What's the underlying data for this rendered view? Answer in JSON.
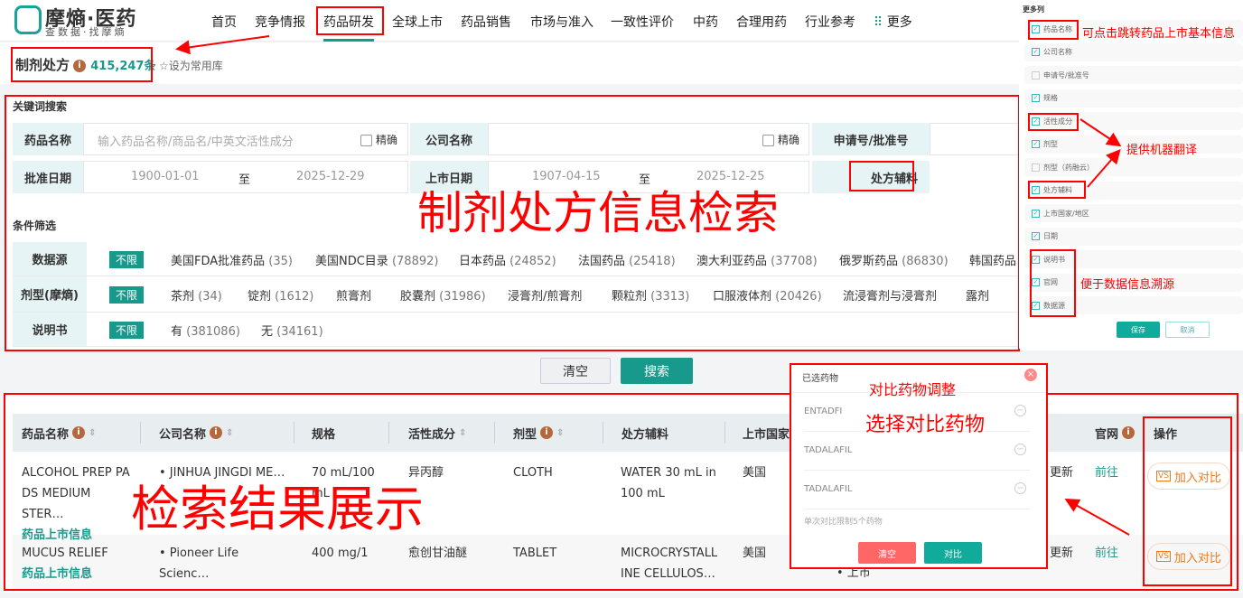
{
  "logo": {
    "title": "摩熵·医药",
    "subtitle": "查数据·找摩熵"
  },
  "nav": [
    "首页",
    "竞争情报",
    "药品研发",
    "全球上市",
    "药品销售",
    "市场与准入",
    "一致性评价",
    "中药",
    "合理用药",
    "行业参考",
    "更多"
  ],
  "page": {
    "title": "制剂处方",
    "count": "415,247条",
    "favorite": "设为常用库"
  },
  "search": {
    "section_label": "关键词搜索",
    "drug_name_label": "药品名称",
    "drug_name_placeholder": "输入药品名称/商品名/中英文活性成分",
    "exact": "精确",
    "company_label": "公司名称",
    "app_no_label": "申请号/批准号",
    "approval_date_label": "批准日期",
    "approval_from": "1900-01-01",
    "to": "至",
    "approval_to": "2025-12-29",
    "market_date_label": "上市日期",
    "market_from": "1907-04-15",
    "market_to": "2025-12-25",
    "excipient_label": "处方辅料"
  },
  "filters": {
    "section_label": "条件筛选",
    "unlimited": "不限",
    "rows": [
      {
        "label": "数据源",
        "options": [
          [
            "美国FDA批准药品",
            "(35)"
          ],
          [
            "美国NDC目录",
            "(78892)"
          ],
          [
            "日本药品",
            "(24852)"
          ],
          [
            "法国药品",
            "(25418)"
          ],
          [
            "澳大利亚药品",
            "(37708)"
          ],
          [
            "俄罗斯药品",
            "(86830)"
          ],
          [
            "韩国药品",
            ""
          ]
        ]
      },
      {
        "label": "剂型(摩熵)",
        "options": [
          [
            "茶剂",
            "(34)"
          ],
          [
            "锭剂",
            "(1612)"
          ],
          [
            "煎膏剂",
            ""
          ],
          [
            "胶囊剂",
            "(31986)"
          ],
          [
            "浸膏剂/煎膏剂",
            ""
          ],
          [
            "颗粒剂",
            "(3313)"
          ],
          [
            "口服液体剂",
            "(20426)"
          ],
          [
            "流浸膏剂与浸膏剂",
            ""
          ],
          [
            "露剂",
            ""
          ]
        ]
      },
      {
        "label": "说明书",
        "options": [
          [
            "有",
            "(381086)"
          ],
          [
            "无",
            "(34161)"
          ]
        ]
      }
    ]
  },
  "buttons": {
    "clear": "清空",
    "search": "搜索"
  },
  "table": {
    "headers": [
      "药品名称",
      "公司名称",
      "规格",
      "活性成分",
      "剂型",
      "处方辅料",
      "上市国家",
      "官网",
      "操作"
    ],
    "rows": [
      {
        "name": "ALCOHOL PREP PA DS MEDIUM STER…",
        "link": "药品上市信息",
        "company": "• JINHUA JINGDI ME…",
        "spec": "70 mL/100 mL",
        "ingredient": "异丙醇",
        "form": "CLOTH",
        "excipient": "WATER 30 mL in 100 mL",
        "country": "美国",
        "status": "更新",
        "site": "前往",
        "action": "加入对比"
      },
      {
        "name": "MUCUS RELIEF",
        "link": "药品上市信息",
        "company": "• Pioneer Life Scienc…",
        "spec": "400 mg/1",
        "ingredient": "愈创甘油醚",
        "form": "TABLET",
        "excipient": "MICROCRYSTALL INE CELLULOS…",
        "country": "美国",
        "status": "更新",
        "extra": "• 上市",
        "site": "前往",
        "action": "加入对比"
      }
    ]
  },
  "compare": {
    "title": "已选药物",
    "items": [
      "ENTADFI",
      "TADALAFIL",
      "TADALAFIL"
    ],
    "note": "单次对比限制5个药物",
    "clear": "清空",
    "compare": "对比"
  },
  "columns_panel": {
    "title": "更多列",
    "items": [
      {
        "label": "药品名称",
        "checked": true
      },
      {
        "label": "公司名称",
        "checked": true
      },
      {
        "label": "申请号/批准号",
        "checked": false
      },
      {
        "label": "规格",
        "checked": true
      },
      {
        "label": "活性成分",
        "checked": true
      },
      {
        "label": "剂型",
        "checked": true
      },
      {
        "label": "剂型（药融云）",
        "checked": false
      },
      {
        "label": "处方辅料",
        "checked": true
      },
      {
        "label": "上市国家/地区",
        "checked": true
      },
      {
        "label": "日期",
        "checked": true
      },
      {
        "label": "说明书",
        "checked": true
      },
      {
        "label": "官网",
        "checked": true
      },
      {
        "label": "数据源",
        "checked": true
      }
    ],
    "save": "保存",
    "cancel": "取消"
  },
  "annotations": {
    "search": "制剂处方信息检索",
    "results": "检索结果展示",
    "compare_adjust": "对比药物调整",
    "select_compare": "选择对比药物",
    "jump": "可点击跳转药品上市基本信息",
    "translate": "提供机器翻译",
    "trace": "便于数据信息溯源"
  },
  "colors": {
    "accent": "#179a8c",
    "annotation": "#ff0000",
    "compare_orange": "#f07a1a"
  }
}
